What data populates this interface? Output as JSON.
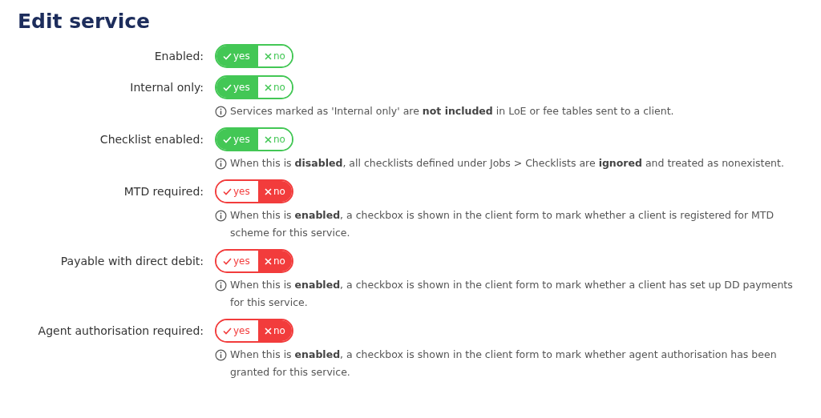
{
  "title": "Edit service",
  "fields": [
    {
      "label": "Enabled:",
      "options": [
        {
          "label": "yes",
          "kind": "yes",
          "selected": true
        },
        {
          "label": "no",
          "kind": "no",
          "selected": false
        }
      ]
    },
    {
      "label": "Internal only:",
      "options": [
        {
          "label": "yes",
          "kind": "yes",
          "selected": true
        },
        {
          "label": "no",
          "kind": "no",
          "selected": false
        }
      ],
      "help": "Services marked as 'Internal only' are **not included** in LoE or fee tables sent to a client."
    },
    {
      "label": "Checklist enabled:",
      "options": [
        {
          "label": "yes",
          "kind": "yes",
          "selected": true
        },
        {
          "label": "no",
          "kind": "no",
          "selected": false
        }
      ],
      "help": "When this is **disabled**, all checklists defined under Jobs > Checklists are **ignored** and treated as nonexistent."
    },
    {
      "label": "MTD required:",
      "options": [
        {
          "label": "yes",
          "kind": "yes",
          "selected": false
        },
        {
          "label": "no",
          "kind": "no",
          "selected": true
        }
      ],
      "help": "When this is **enabled**, a checkbox is shown in the client form to mark whether a client is registered for MTD scheme for this service."
    },
    {
      "label": "Payable with direct debit:",
      "options": [
        {
          "label": "yes",
          "kind": "yes",
          "selected": false
        },
        {
          "label": "no",
          "kind": "no",
          "selected": true
        }
      ],
      "help": "When this is **enabled**, a checkbox is shown in the client form to mark whether a client has set up DD payments for this service."
    },
    {
      "label": "Agent authorisation required:",
      "options": [
        {
          "label": "yes",
          "kind": "yes",
          "selected": false
        },
        {
          "label": "no",
          "kind": "no",
          "selected": true
        }
      ],
      "help": "When this is **enabled**, a checkbox is shown in the client form to mark whether agent authorisation has been granted for this service."
    }
  ]
}
